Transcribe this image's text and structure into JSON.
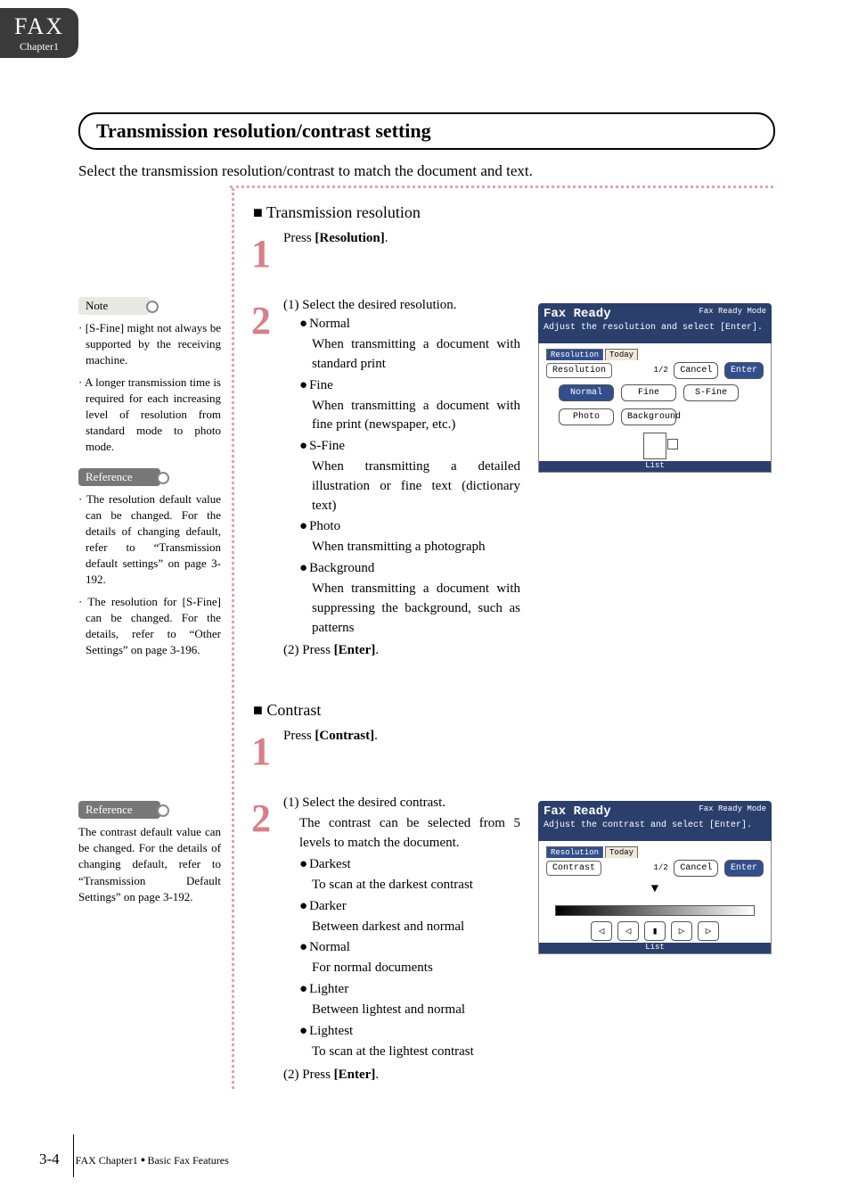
{
  "tab": {
    "title": "FAX",
    "subtitle": "Chapter1"
  },
  "heading": "Transmission resolution/contrast setting",
  "intro": "Select the transmission resolution/contrast to match the document and text.",
  "resolution": {
    "title": "Transmission resolution",
    "step1": {
      "num": "1",
      "pre": "Press ",
      "bold": "[Resolution]",
      "post": "."
    },
    "step2": {
      "num": "2",
      "lead": "(1) Select the desired resolution.",
      "items": [
        {
          "name": "Normal",
          "desc": "When transmitting a document with standard print"
        },
        {
          "name": "Fine",
          "desc": "When transmitting a document with fine print (newspaper, etc.)"
        },
        {
          "name": "S-Fine",
          "desc": "When transmitting a detailed illustration or fine text (dictionary text)"
        },
        {
          "name": "Photo",
          "desc": "When transmitting a photograph"
        },
        {
          "name": "Background",
          "desc": "When transmitting a document with suppressing the background, such as patterns"
        }
      ],
      "press_pre": "(2) Press ",
      "press_bold": "[Enter]",
      "press_post": "."
    }
  },
  "contrast": {
    "title": "Contrast",
    "step1": {
      "num": "1",
      "pre": "Press ",
      "bold": "[Contrast]",
      "post": "."
    },
    "step2": {
      "num": "2",
      "lead": "(1) Select the desired contrast.",
      "sub": "The contrast can be selected from 5 levels to match the document.",
      "items": [
        {
          "name": "Darkest",
          "desc": "To scan at the darkest contrast"
        },
        {
          "name": "Darker",
          "desc": "Between darkest and normal"
        },
        {
          "name": "Normal",
          "desc": "For normal documents"
        },
        {
          "name": "Lighter",
          "desc": "Between lightest and normal"
        },
        {
          "name": "Lightest",
          "desc": "To scan at the lightest contrast"
        }
      ],
      "press_pre": "(2) Press ",
      "press_bold": "[Enter]",
      "press_post": "."
    }
  },
  "sidebar": {
    "note_label": "Note",
    "ref_label": "Reference",
    "note1": "· [S-Fine] might not always be supported by the receiving machine.",
    "note2": "· A longer transmission time is required for each increasing level of resolution from standard mode to photo mode.",
    "ref1": "· The resolution default value can be changed. For the details of changing default, refer to “Transmission default settings” on page 3-192.",
    "ref2": "· The resolution for [S-Fine] can be changed. For the details, refer to “Other Settings” on page 3-196.",
    "ref3": "The contrast default value can be changed. For the details of changing default, refer to “Transmission Default Settings” on page 3-192."
  },
  "lcd1": {
    "title": "Fax Ready",
    "mode": "Fax Ready Mode",
    "msg": "Adjust the resolution and select [Enter].",
    "tab_active": "Resolution",
    "tab_other": "Today",
    "param": "Resolution",
    "pager": "1/2",
    "cancel": "Cancel",
    "enter": "Enter",
    "buttons": [
      "Normal",
      "Fine",
      "S-Fine",
      "Photo",
      "Background"
    ],
    "footer": "List"
  },
  "lcd2": {
    "title": "Fax Ready",
    "mode": "Fax Ready Mode",
    "msg": "Adjust the contrast and select [Enter].",
    "tab_active": "Resolution",
    "tab_other": "Today",
    "param": "Contrast",
    "pager": "1/2",
    "cancel": "Cancel",
    "enter": "Enter",
    "arrows": [
      "◁",
      "◁",
      "▮",
      "▷",
      "▷"
    ],
    "footer": "List"
  },
  "footer": {
    "page": "3-4",
    "crumb1": "FAX Chapter1",
    "crumb2": "Basic Fax Features"
  }
}
